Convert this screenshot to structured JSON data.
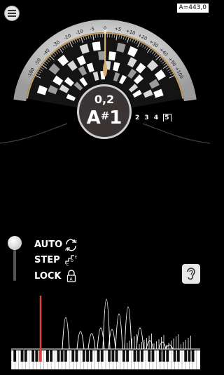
{
  "app": {
    "calibration": "A=443,0"
  },
  "dial": {
    "cents_display": "0,2",
    "note_letter": "A",
    "note_accidental": "#",
    "note_octave": "1",
    "scale_labels": [
      "-100",
      "-50",
      "-40",
      "-30",
      "-20",
      "-10",
      "-5",
      "0",
      "+5",
      "+10",
      "+20",
      "+30",
      "+40",
      "+50",
      "+100"
    ],
    "octave_labels": [
      "2",
      "3",
      "4",
      "5"
    ],
    "needle_cents": 0.2
  },
  "modes": {
    "auto_label": "AUTO",
    "step_label": "STEP",
    "lock_label": "LOCK",
    "auto_icon": "rotate-arrows-icon",
    "step_icon": "step-notes-icon",
    "lock_icon": "padlock-icon",
    "selected": "AUTO"
  },
  "ear_button": {
    "icon": "ear-icon"
  },
  "spectrum": {
    "highlight_color": "#e04040"
  }
}
